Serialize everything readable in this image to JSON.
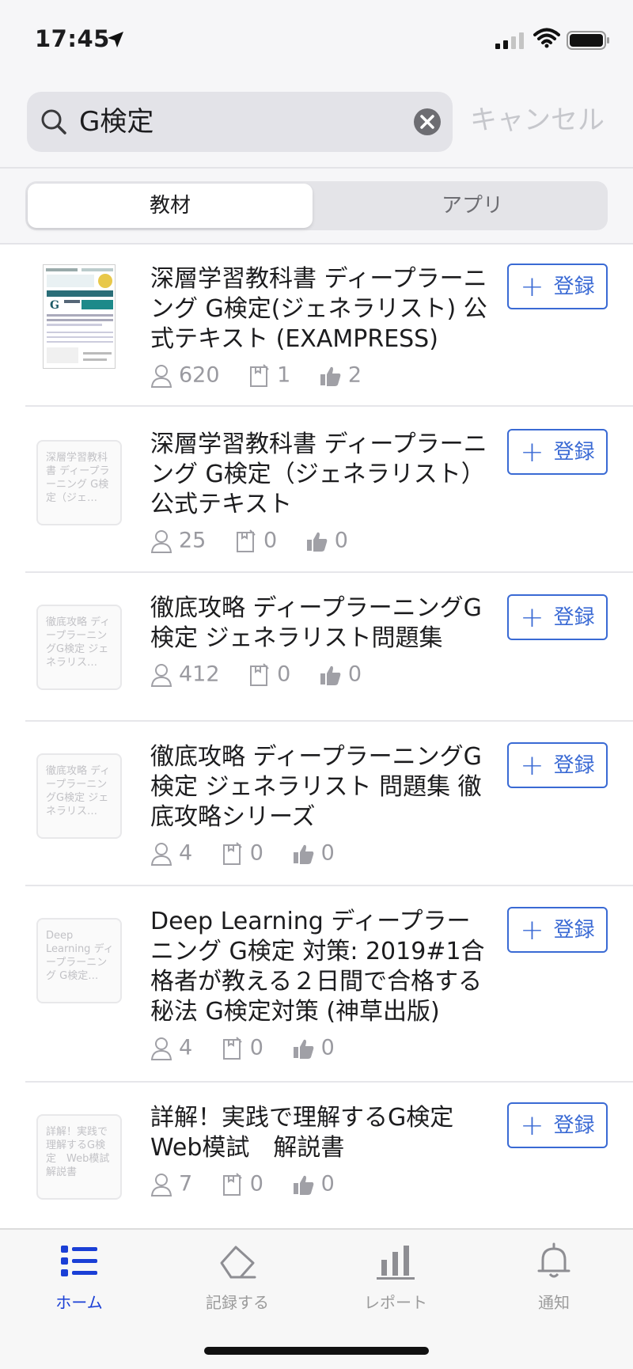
{
  "status": {
    "time": "17:45"
  },
  "search": {
    "query": "G検定",
    "cancel_label": "キャンセル"
  },
  "segments": [
    {
      "label": "教材",
      "active": true
    },
    {
      "label": "アプリ",
      "active": false
    }
  ],
  "accent_color": "#3a6ad4",
  "results": [
    {
      "title": "深層学習教科書 ディープラーニング G検定(ジェネラリスト) 公式テキスト (EXAMPRESS)",
      "thumb_text": "",
      "users": "620",
      "records": "1",
      "likes": "2",
      "register_label": "登録"
    },
    {
      "title": "深層学習教科書 ディープラーニング G検定（ジェネラリスト）公式テキスト",
      "thumb_text": "深層学習教科書 ディープラーニング G検定（ジェ…",
      "users": "25",
      "records": "0",
      "likes": "0",
      "register_label": "登録"
    },
    {
      "title": "徹底攻略 ディープラーニングG検定 ジェネラリスト問題集",
      "thumb_text": "徹底攻略 ディープラーニングG検定 ジェネラリス…",
      "users": "412",
      "records": "0",
      "likes": "0",
      "register_label": "登録"
    },
    {
      "title": "徹底攻略 ディープラーニングG検定 ジェネラリスト 問題集 徹底攻略シリーズ",
      "thumb_text": "徹底攻略 ディープラーニングG検定 ジェネラリス…",
      "users": "4",
      "records": "0",
      "likes": "0",
      "register_label": "登録"
    },
    {
      "title": "Deep Learning ディープラーニング G検定 対策: 2019#1合格者が教える２日間で合格する秘法 G検定対策 (神草出版)",
      "thumb_text": "Deep Learning ディープラーニング G検定…",
      "users": "4",
      "records": "0",
      "likes": "0",
      "register_label": "登録"
    },
    {
      "title": "詳解！実践で理解するG検定 Web模試　解説書",
      "thumb_text": "詳解！実践で理解するG検定　Web模試　解説書",
      "users": "7",
      "records": "0",
      "likes": "0",
      "register_label": "登録"
    }
  ],
  "tabs": [
    {
      "label": "ホーム",
      "icon": "list-icon",
      "active": true
    },
    {
      "label": "記録する",
      "icon": "eraser-icon",
      "active": false
    },
    {
      "label": "レポート",
      "icon": "bar-chart-icon",
      "active": false
    },
    {
      "label": "通知",
      "icon": "bell-icon",
      "active": false
    }
  ]
}
